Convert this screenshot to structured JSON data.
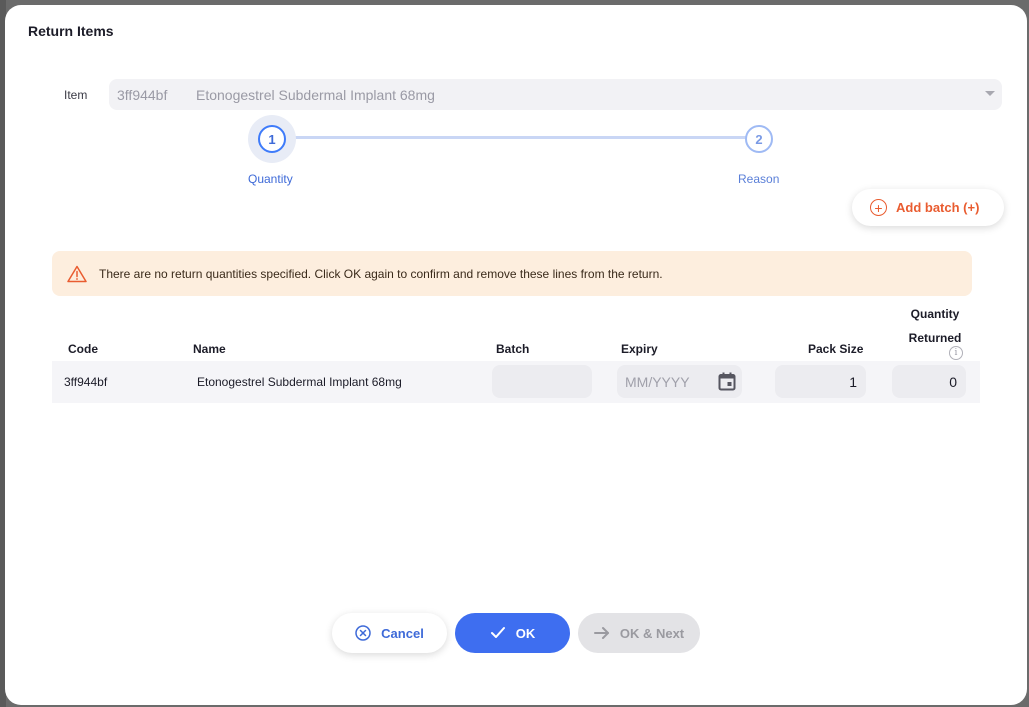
{
  "dialog": {
    "title": "Return Items"
  },
  "item": {
    "label": "Item",
    "code": "3ff944bf",
    "name": "Etonogestrel Subdermal Implant 68mg"
  },
  "stepper": {
    "steps": [
      {
        "number": "1",
        "label": "Quantity"
      },
      {
        "number": "2",
        "label": "Reason"
      }
    ],
    "active_step": 1
  },
  "add_batch_label": "Add batch (+)",
  "alert": {
    "message": "There are no return quantities specified. Click OK again to confirm and remove these lines from the return."
  },
  "table": {
    "columns": {
      "code": "Code",
      "name": "Name",
      "batch": "Batch",
      "expiry": "Expiry",
      "pack_size": "Pack Size",
      "quantity_returned": "Quantity Returned"
    },
    "rows": [
      {
        "code": "3ff944bf",
        "name": "Etonogestrel Subdermal Implant 68mg",
        "batch": "",
        "expiry_placeholder": "MM/YYYY",
        "pack_size": "1",
        "quantity_returned": "0"
      }
    ]
  },
  "buttons": {
    "cancel": "Cancel",
    "ok": "OK",
    "ok_next": "OK & Next"
  },
  "colors": {
    "primary": "#3e6ef0",
    "accent_orange": "#e95c30",
    "alert_bg": "#fdeede"
  }
}
